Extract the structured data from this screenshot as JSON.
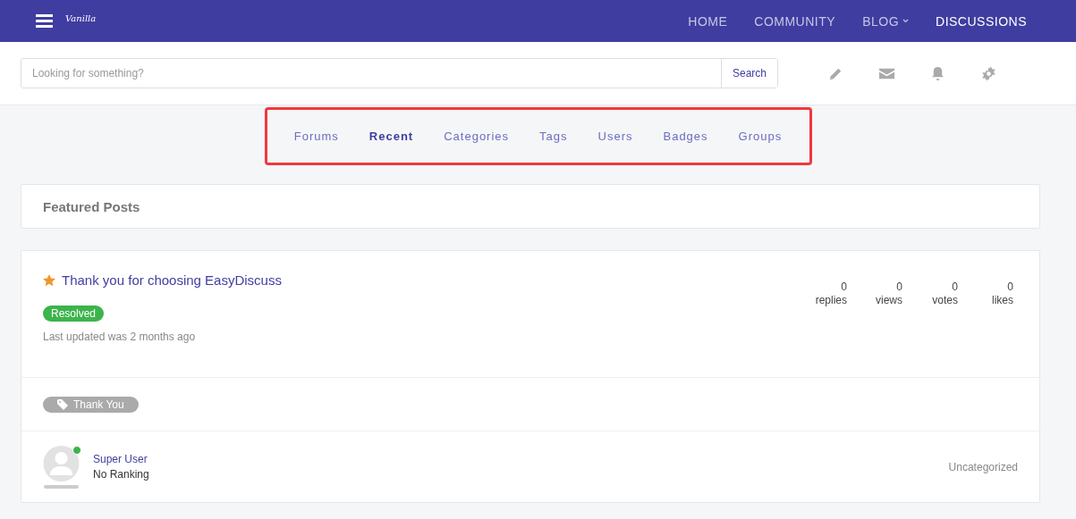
{
  "header": {
    "logo": "Vanilla",
    "nav": [
      {
        "label": "HOME",
        "selected": false,
        "dropdown": false
      },
      {
        "label": "COMMUNITY",
        "selected": false,
        "dropdown": false
      },
      {
        "label": "BLOG",
        "selected": false,
        "dropdown": true
      },
      {
        "label": "DISCUSSIONS",
        "selected": true,
        "dropdown": false
      }
    ]
  },
  "search": {
    "placeholder": "Looking for something?",
    "button": "Search"
  },
  "tabs": [
    {
      "label": "Forums",
      "selected": false
    },
    {
      "label": "Recent",
      "selected": true
    },
    {
      "label": "Categories",
      "selected": false
    },
    {
      "label": "Tags",
      "selected": false
    },
    {
      "label": "Users",
      "selected": false
    },
    {
      "label": "Badges",
      "selected": false
    },
    {
      "label": "Groups",
      "selected": false
    }
  ],
  "featured": {
    "title": "Featured Posts"
  },
  "post": {
    "title": "Thank you for choosing EasyDiscuss",
    "featured": true,
    "status": "Resolved",
    "updated": "Last updated was 2 months ago",
    "stats": [
      {
        "value": "0",
        "label": "replies"
      },
      {
        "value": "0",
        "label": "views"
      },
      {
        "value": "0",
        "label": "votes"
      },
      {
        "value": "0",
        "label": "likes"
      }
    ],
    "tags": [
      "Thank You"
    ],
    "author": {
      "name": "Super User",
      "rank": "No Ranking",
      "online": true
    },
    "category": "Uncategorized"
  }
}
